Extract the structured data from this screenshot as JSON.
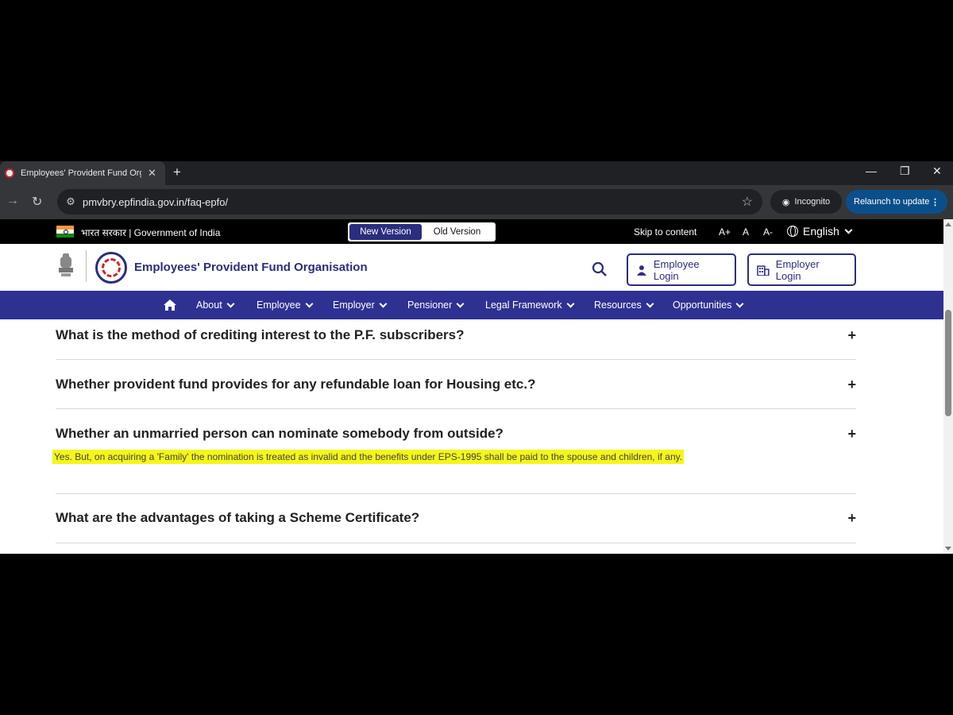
{
  "browser": {
    "tab_title": "Employees' Provident Fund Org",
    "url": "pmvbry.epfindia.gov.in/faq-epfo/",
    "incognito_label": "Incognito",
    "relaunch_label": "Relaunch to update"
  },
  "gov_bar": {
    "text": "भारत सरकार | Government of India",
    "new_version": "New Version",
    "old_version": "Old Version",
    "skip": "Skip to content",
    "font_increase": "A+",
    "font_normal": "A",
    "font_decrease": "A-",
    "language": "English"
  },
  "header": {
    "org_name": "Employees' Provident Fund Organisation",
    "employee_login": "Employee Login",
    "employer_login": "Employer Login"
  },
  "nav": {
    "items": [
      "About",
      "Employee",
      "Employer",
      "Pensioner",
      "Legal Framework",
      "Resources",
      "Opportunities"
    ]
  },
  "faq": [
    {
      "question": "What is the method of crediting interest to the P.F. subscribers?",
      "toggle": "+"
    },
    {
      "question": "Whether provident fund provides for any refundable loan for Housing etc.?",
      "toggle": "+"
    },
    {
      "question": "Whether an unmarried person can nominate somebody from outside?",
      "toggle": "+",
      "answer": "Yes. But, on acquiring a 'Family' the nomination is treated as invalid and the benefits under EPS-1995 shall be paid to the spouse and children, if any."
    },
    {
      "question": "What are the advantages of taking a Scheme Certificate?",
      "toggle": "+"
    }
  ],
  "colors": {
    "brand": "#2e3192",
    "highlight": "#f5f51a"
  }
}
